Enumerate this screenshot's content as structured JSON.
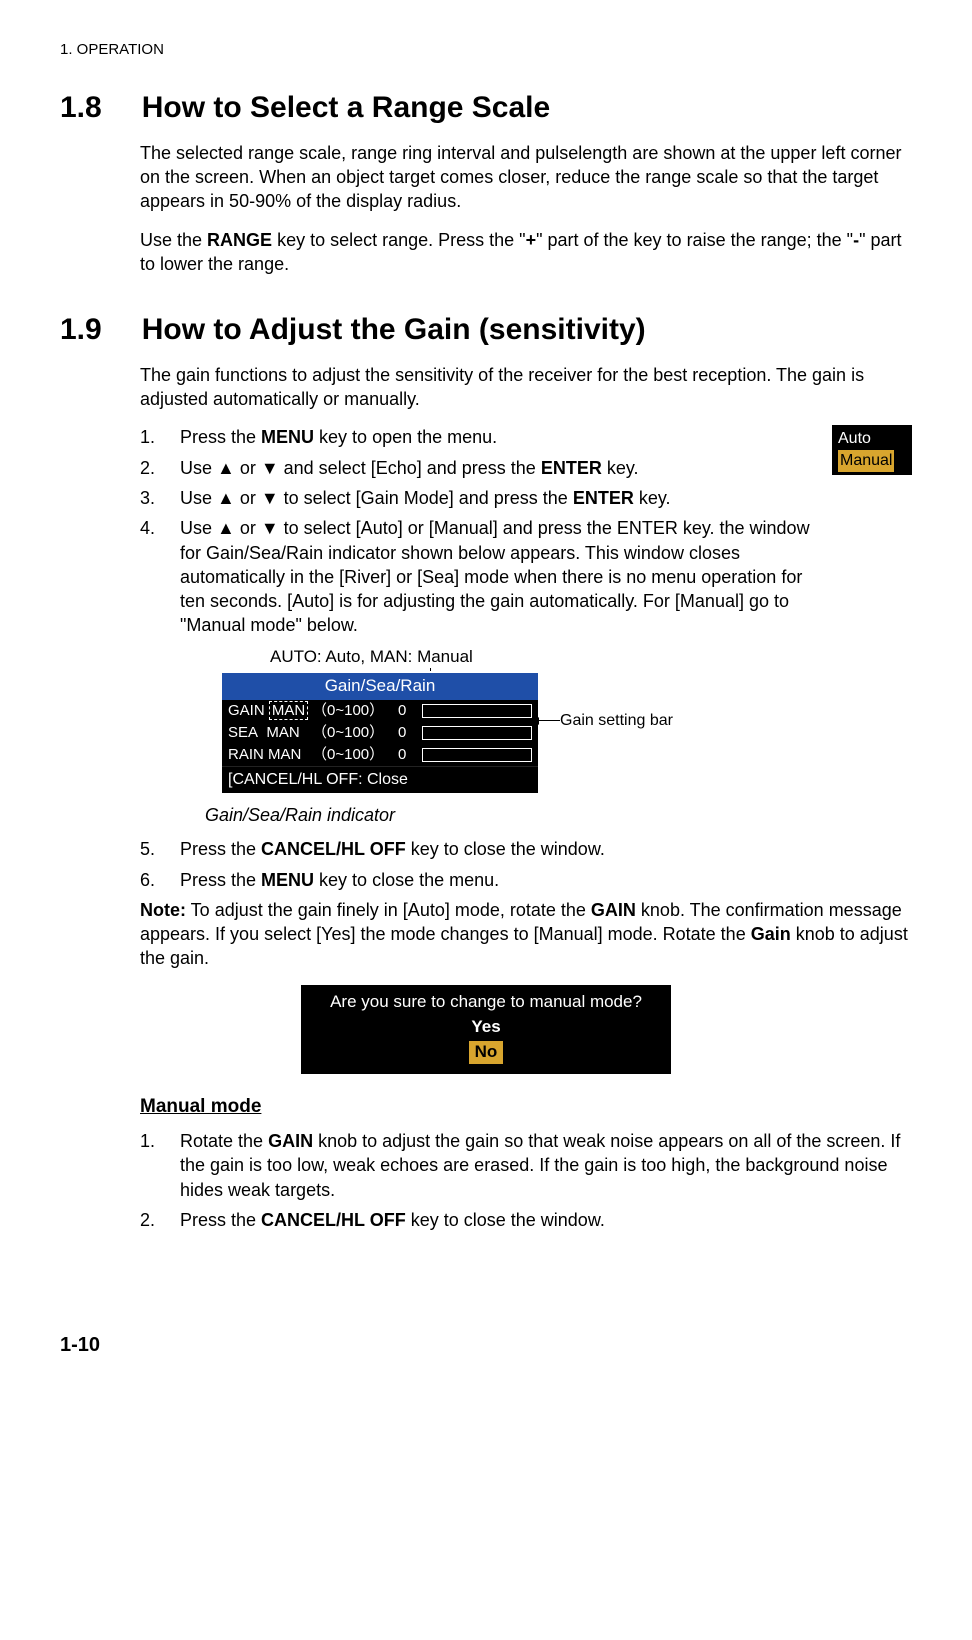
{
  "header": "1.  OPERATION",
  "section1": {
    "number": "1.8",
    "title": "How to Select a Range Scale",
    "para1": "The selected range scale, range ring interval and pulselength are shown at the upper left corner on the screen. When an object target comes closer, reduce the range scale so that the target appears in 50-90% of the display radius.",
    "para2_pre": "Use the ",
    "para2_b1": "RANGE",
    "para2_mid1": " key to select range. Press the \"",
    "para2_b2": "+",
    "para2_mid2": "\" part of the key to raise the range; the \"",
    "para2_b3": "-",
    "para2_end": "\" part to lower the range."
  },
  "section2": {
    "number": "1.9",
    "title": "How to Adjust the Gain (sensitivity)",
    "intro": "The gain functions to adjust the sensitivity of the receiver for the best reception. The gain is adjusted automatically or manually.",
    "steps": [
      {
        "n": "1.",
        "pre": "Press the ",
        "b": "MENU",
        "post": " key to open the menu."
      },
      {
        "n": "2.",
        "pre": "Use ▲ or ▼ and select [Echo] and press the ",
        "b": "ENTER",
        "post": " key."
      },
      {
        "n": "3.",
        "pre": "Use ▲ or ▼ to select [Gain Mode] and press the ",
        "b": "ENTER",
        "post": " key."
      },
      {
        "n": "4.",
        "pre": "Use ▲ or ▼ to select [Auto] or [Manual] and press the ENTER key. the window for Gain/Sea/Rain indicator shown below appears. This window closes automatically in the [River] or [Sea] mode when there is no menu operation for ten seconds. [Auto] is for adjusting the gain automatically. For [Manual] go to \"Manual mode\" below.",
        "b": "",
        "post": ""
      }
    ],
    "autoManual": {
      "auto": "Auto",
      "manual": "Manual"
    },
    "figLabelAbove": "AUTO: Auto, MAN: Manual",
    "gsr": {
      "title": "Gain/Sea/Rain",
      "rows": [
        {
          "label": "GAIN",
          "mode": "MAN",
          "range": "（0~100）",
          "val": "0"
        },
        {
          "label": "SEA",
          "mode": "MAN",
          "range": "（0~100）",
          "val": "0"
        },
        {
          "label": "RAIN",
          "mode": "MAN",
          "range": "（0~100）",
          "val": "0"
        }
      ],
      "footer": "[CANCEL/HL OFF: Close"
    },
    "gainBarLabel": "Gain setting bar",
    "figCaptionBelow": "Gain/Sea/Rain indicator",
    "step5": {
      "n": "5.",
      "pre": "Press the ",
      "b": "CANCEL/HL OFF",
      "post": " key to close the window."
    },
    "step6": {
      "n": "6.",
      "pre": "Press the ",
      "b": "MENU",
      "post": " key to close the menu."
    },
    "note_b": "Note:",
    "note_pre": " To adjust the gain finely in [Auto] mode, rotate the ",
    "note_b2": "GAIN",
    "note_mid": " knob. The confirmation message appears. If you select [Yes] the mode changes to [Manual] mode. Rotate the ",
    "note_b3": "Gain",
    "note_end": " knob to adjust the gain.",
    "confirm": {
      "q": "Are you sure to change to manual mode?",
      "yes": "Yes",
      "no": "No"
    },
    "manualTitle": "Manual mode",
    "manualSteps": [
      {
        "n": "1.",
        "pre": "Rotate the ",
        "b": "GAIN",
        "post": " knob to adjust the gain so that weak noise appears on all of the screen. If the gain is too low, weak echoes are erased. If the gain is too high, the background noise hides weak targets."
      },
      {
        "n": "2.",
        "pre": "Press the ",
        "b": "CANCEL/HL OFF",
        "post": " key to close the window."
      }
    ]
  },
  "pageNumber": "1-10"
}
